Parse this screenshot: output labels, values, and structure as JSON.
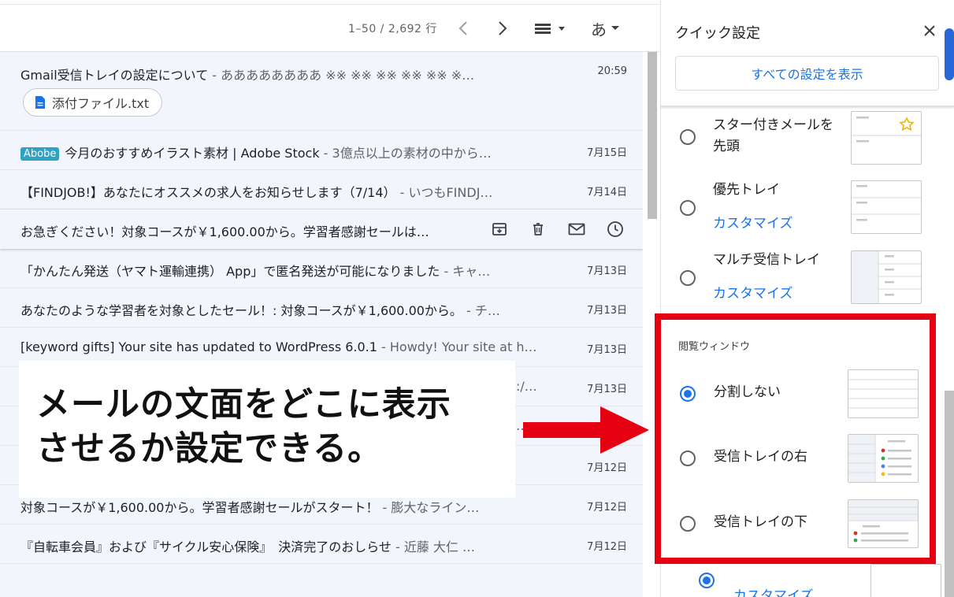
{
  "toolbar": {
    "pager": "1–50 / 2,692 行",
    "input_tools_label": "あ"
  },
  "emails": [
    {
      "text": "Gmail受信トレイの設定について",
      "snippet": " - ああああああああ ※※ ※※ ※※ ※※ ※※ ※…",
      "date": "20:59",
      "attachment": "添付ファイル.txt"
    },
    {
      "badge": "Abobe",
      "text": "今月のおすすめイラスト素材 | Adobe Stock",
      "snippet": " - 3億点以上の素材の中から…",
      "date": "7月15日"
    },
    {
      "text": "【FINDJOB!】あなたにオススメの求人をお知らせします（7/14）",
      "snippet": " - いつもFINDJ…",
      "date": "7月14日"
    },
    {
      "text": "お急ぎください！対象コースが￥1,600.00から。学習者感謝セールは…",
      "snippet": "",
      "date": ""
    },
    {
      "text": "「かんたん発送（ヤマト運輸連携） App」で匿名発送が可能になりました",
      "snippet": " - キャ…",
      "date": "7月13日"
    },
    {
      "text": "あなたのような学習者を対象としたセール！: 対象コースが￥1,600.00から。",
      "snippet": " - チ…",
      "date": "7月13日"
    },
    {
      "text": "[keyword gifts] Your site has updated to WordPress 6.0.1",
      "snippet": " - Howdy! Your site at h…",
      "date": "7月13日"
    },
    {
      "text": "",
      "snippet": ":/…",
      "date": "7月13日"
    },
    {
      "text": "",
      "snippet": "…",
      "date": ""
    },
    {
      "text": "",
      "snippet": "",
      "date": "7月12日"
    },
    {
      "text": "対象コースが￥1,600.00から。学習者感謝セールがスタート！",
      "snippet": " - 膨大なライン…",
      "date": "7月12日"
    },
    {
      "text": "『自転車会員』および『サイクル安心保険』　決済完了のおしらせ",
      "snippet": " - 近藤 大仁 …",
      "date": "7月12日"
    }
  ],
  "callout": {
    "line1": "メールの文面をどこに表示",
    "line2": "させるか設定できる。"
  },
  "quick_settings": {
    "title": "クイック設定",
    "all_settings_button": "すべての設定を表示",
    "inbox_types": [
      {
        "label_line1": "スター付きメールを",
        "label_line2": "先頭",
        "customize": ""
      },
      {
        "label_line1": "優先トレイ",
        "label_line2": "",
        "customize": "カスタマイズ"
      },
      {
        "label_line1": "マルチ受信トレイ",
        "label_line2": "",
        "customize": "カスタマイズ"
      }
    ],
    "reading_pane": {
      "section_label": "閲覧ウィンドウ",
      "options": [
        {
          "label": "分割しない",
          "checked": true
        },
        {
          "label": "受信トレイの右",
          "checked": false
        },
        {
          "label": "受信トレイの下",
          "checked": false
        }
      ]
    },
    "below_frame": {
      "customize": "カスタマイズ"
    }
  },
  "colors": {
    "accent": "#1a73e8",
    "highlight_frame": "#e50012",
    "row_background": "#f2f6fc"
  }
}
